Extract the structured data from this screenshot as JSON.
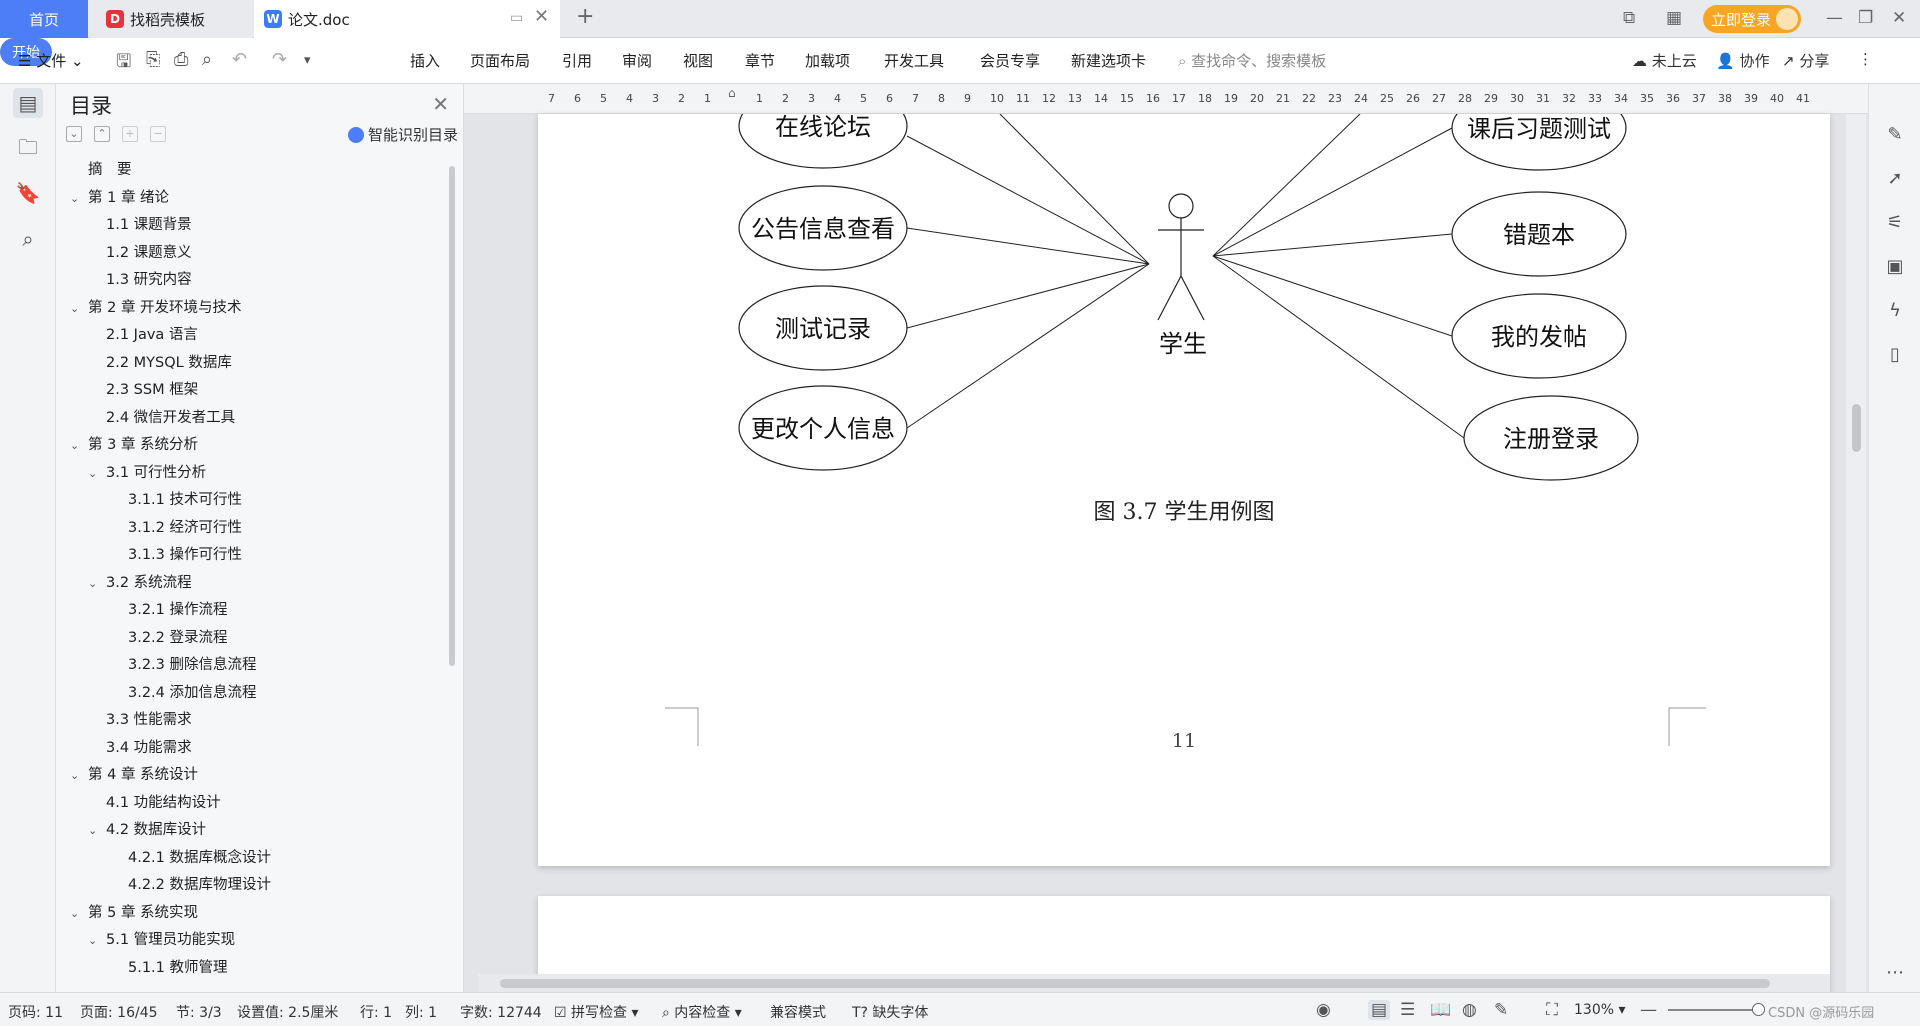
{
  "tabs": {
    "home": "首页",
    "template": "找稻壳模板",
    "doc": "论文.doc"
  },
  "account": {
    "login": "立即登录"
  },
  "menu": {
    "file": "文件",
    "items": [
      "开始",
      "插入",
      "页面布局",
      "引用",
      "审阅",
      "视图",
      "章节",
      "加载项",
      "开发工具",
      "会员专享",
      "新建选项卡"
    ],
    "search_placeholder": "查找命令、搜索模板",
    "cloud": "未上云",
    "collab": "协作",
    "share": "分享"
  },
  "toc": {
    "title": "目录",
    "smart": "智能识别目录",
    "items": [
      {
        "text": "摘　要",
        "level": 1,
        "caret": ""
      },
      {
        "text": "第 1 章  绪论",
        "level": 1,
        "caret": "v"
      },
      {
        "text": "1.1  课题背景",
        "level": 2,
        "caret": ""
      },
      {
        "text": "1.2  课题意义",
        "level": 2,
        "caret": ""
      },
      {
        "text": "1.3  研究内容",
        "level": 2,
        "caret": ""
      },
      {
        "text": "第 2 章  开发环境与技术",
        "level": 1,
        "caret": "v"
      },
      {
        "text": "2.1 Java 语言",
        "level": 2,
        "caret": ""
      },
      {
        "text": "2.2 MYSQL 数据库",
        "level": 2,
        "caret": ""
      },
      {
        "text": "2.3 SSM 框架",
        "level": 2,
        "caret": ""
      },
      {
        "text": "2.4 微信开发者工具",
        "level": 2,
        "caret": ""
      },
      {
        "text": "第 3 章  系统分析",
        "level": 1,
        "caret": "v"
      },
      {
        "text": "3.1  可行性分析",
        "level": 2,
        "caret": "v"
      },
      {
        "text": "3.1.1  技术可行性",
        "level": 3,
        "caret": ""
      },
      {
        "text": "3.1.2  经济可行性",
        "level": 3,
        "caret": ""
      },
      {
        "text": "3.1.3  操作可行性",
        "level": 3,
        "caret": ""
      },
      {
        "text": "3.2  系统流程",
        "level": 2,
        "caret": "v"
      },
      {
        "text": "3.2.1  操作流程",
        "level": 3,
        "caret": ""
      },
      {
        "text": "3.2.2  登录流程",
        "level": 3,
        "caret": ""
      },
      {
        "text": "3.2.3  删除信息流程",
        "level": 3,
        "caret": ""
      },
      {
        "text": "3.2.4  添加信息流程",
        "level": 3,
        "caret": ""
      },
      {
        "text": "3.3  性能需求",
        "level": 2,
        "caret": ""
      },
      {
        "text": "3.4  功能需求",
        "level": 2,
        "caret": ""
      },
      {
        "text": "第 4 章  系统设计",
        "level": 1,
        "caret": "v"
      },
      {
        "text": "4.1  功能结构设计",
        "level": 2,
        "caret": ""
      },
      {
        "text": "4.2  数据库设计",
        "level": 2,
        "caret": "v"
      },
      {
        "text": "4.2.1  数据库概念设计",
        "level": 3,
        "caret": ""
      },
      {
        "text": "4.2.2  数据库物理设计",
        "level": 3,
        "caret": ""
      },
      {
        "text": "第 5 章  系统实现",
        "level": 1,
        "caret": "v"
      },
      {
        "text": "5.1  管理员功能实现",
        "level": 2,
        "caret": "v"
      },
      {
        "text": "5.1.1  教师管理",
        "level": 3,
        "caret": ""
      }
    ]
  },
  "ruler": [
    "7",
    "6",
    "5",
    "4",
    "3",
    "2",
    "1",
    "",
    "1",
    "2",
    "3",
    "4",
    "5",
    "6",
    "7",
    "8",
    "9",
    "10",
    "11",
    "12",
    "13",
    "14",
    "15",
    "16",
    "17",
    "18",
    "19",
    "20",
    "21",
    "22",
    "23",
    "24",
    "25",
    "26",
    "27",
    "28",
    "29",
    "30",
    "31",
    "32",
    "33",
    "34",
    "35",
    "36",
    "37",
    "38",
    "39",
    "40",
    "41"
  ],
  "diagram": {
    "actor": "学生",
    "left": [
      "在线论坛",
      "公告信息查看",
      "测试记录",
      "更改个人信息"
    ],
    "right": [
      "课后习题测试",
      "错题本",
      "我的发帖",
      "注册登录"
    ],
    "caption": "图 3.7  学生用例图",
    "page_number": "11"
  },
  "status": {
    "page": "页码: 11",
    "pages": "页面: 16/45",
    "section": "节: 3/3",
    "setting": "设置值: 2.5厘米",
    "row": "行: 1",
    "col": "列: 1",
    "words": "字数: 12744",
    "spell": "拼写检查",
    "content": "内容检查",
    "compat": "兼容模式",
    "font": "缺失字体",
    "zoom": "130%"
  },
  "watermark": "CSDN @源码乐园"
}
